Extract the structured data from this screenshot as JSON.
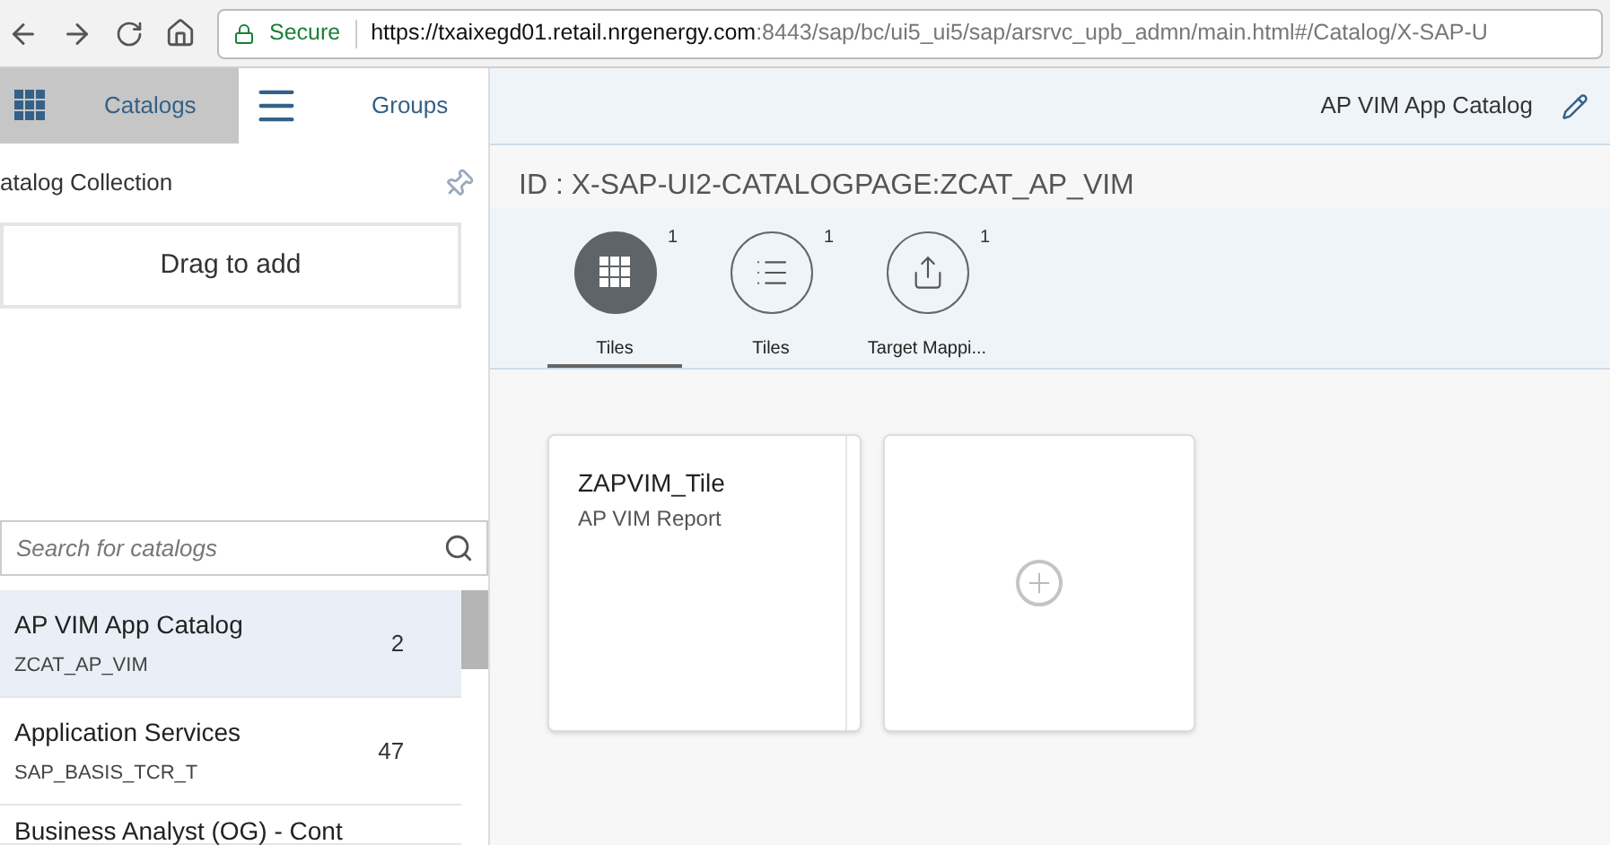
{
  "browser": {
    "secure_label": "Secure",
    "url_host": "https://txaixegd01.retail.nrgenergy.com",
    "url_rest": ":8443/sap/bc/ui5_ui5/sap/arsrvc_upb_admn/main.html#/Catalog/X-SAP-U"
  },
  "nav_tabs": [
    {
      "label": "Catalogs",
      "kind": "grid",
      "selected": true
    },
    {
      "label": "Groups",
      "kind": "menu",
      "selected": false
    }
  ],
  "sidebar": {
    "title": "atalog Collection",
    "drop_zone": "Drag to add",
    "search": {
      "placeholder": "Search for catalogs"
    },
    "items": [
      {
        "title": "AP VIM App Catalog",
        "id": "ZCAT_AP_VIM",
        "count": "2",
        "selected": true
      },
      {
        "title": "Application Services",
        "id": "SAP_BASIS_TCR_T",
        "count": "47",
        "selected": false
      },
      {
        "title": "Business Analyst (OG) - Cont",
        "selected": false
      }
    ]
  },
  "header": {
    "title": "AP VIM App Catalog"
  },
  "page_id": "ID : X-SAP-UI2-CATALOGPAGE:ZCAT_AP_VIM",
  "content_tabs": [
    {
      "label": "Tiles",
      "kind": "grid",
      "count": "1",
      "selected": true
    },
    {
      "label": "Tiles",
      "kind": "list",
      "count": "1",
      "selected": false
    },
    {
      "label": "Target Mappi...",
      "kind": "share",
      "count": "1",
      "selected": false
    }
  ],
  "tiles": [
    {
      "kind": "app",
      "title": "ZAPVIM_Tile",
      "subtitle": "AP VIM Report"
    },
    {
      "kind": "add"
    }
  ]
}
